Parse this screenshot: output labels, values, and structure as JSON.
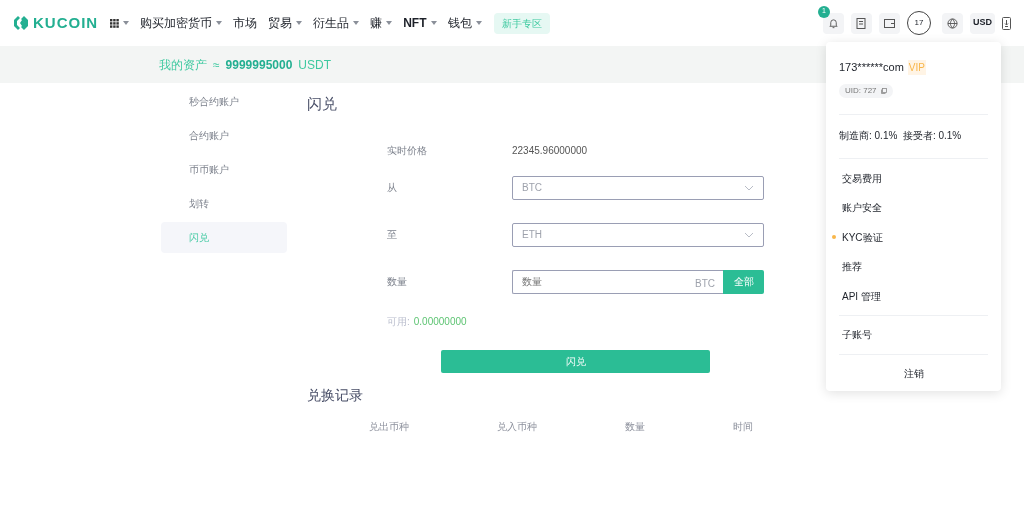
{
  "nav": {
    "logo": "KUCOIN",
    "items": [
      {
        "label": "购买加密货币",
        "dropdown": true,
        "bold": false
      },
      {
        "label": "市场",
        "dropdown": false,
        "bold": false
      },
      {
        "label": "贸易",
        "dropdown": true,
        "bold": false
      },
      {
        "label": "衍生品",
        "dropdown": true,
        "bold": false
      },
      {
        "label": "赚",
        "dropdown": true,
        "bold": false
      },
      {
        "label": "NFT",
        "dropdown": true,
        "bold": true
      },
      {
        "label": "钱包",
        "dropdown": true,
        "bold": false
      }
    ],
    "promo": "新手专区",
    "notification_count": "1",
    "avatar": "17",
    "currency": "USD"
  },
  "assets": {
    "label": "我的资产",
    "approx": "≈",
    "amount": "9999995000",
    "unit": "USDT"
  },
  "sidebar": {
    "items": [
      {
        "label": "秒合约账户",
        "selected": false
      },
      {
        "label": "合约账户",
        "selected": false
      },
      {
        "label": "币币账户",
        "selected": false
      },
      {
        "label": "划转",
        "selected": false
      },
      {
        "label": "闪兑",
        "selected": true
      }
    ]
  },
  "exchange": {
    "title": "闪兑",
    "price_label": "实时价格",
    "price": "22345.96000000",
    "from_label": "从",
    "from": {
      "placeholder": "BTC"
    },
    "to_label": "至",
    "to": {
      "placeholder": "ETH"
    },
    "amount_label": "数量",
    "amount": {
      "placeholder": "数量",
      "suffix": "BTC"
    },
    "all_button": "全部",
    "available_label": "可用:",
    "available": "0.00000000",
    "submit": "闪兑"
  },
  "records": {
    "title": "兑换记录",
    "columns": [
      "兑出币种",
      "兑入币种",
      "数量",
      "时间"
    ]
  },
  "account_menu": {
    "user": "173******com",
    "badge": "VIP",
    "uid": "UID: 727",
    "fees": "制造商: 0.1%  接受者: 0.1%",
    "groups": [
      [
        {
          "label": "交易费用",
          "alert": false
        },
        {
          "label": "账户安全",
          "alert": false
        },
        {
          "label": "KYC验证",
          "alert": true
        },
        {
          "label": "推荐",
          "alert": false
        },
        {
          "label": "API 管理",
          "alert": false
        }
      ],
      [
        {
          "label": "子账号",
          "alert": false
        }
      ]
    ],
    "logout": "注销"
  }
}
